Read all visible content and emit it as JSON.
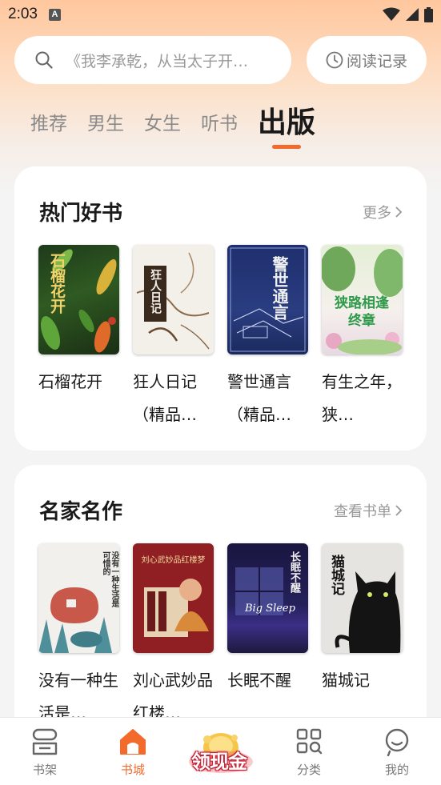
{
  "status": {
    "time": "2:03",
    "notification_letter": "A"
  },
  "search": {
    "placeholder": "《我李承乾，从当太子开…",
    "history_label": "阅读记录"
  },
  "tabs": [
    {
      "label": "推荐"
    },
    {
      "label": "男生"
    },
    {
      "label": "女生"
    },
    {
      "label": "听书"
    },
    {
      "label": "出版"
    }
  ],
  "sections": [
    {
      "title": "热门好书",
      "more_label": "更多",
      "books": [
        {
          "title": "石榴花开",
          "cover_text": "石榴花开"
        },
        {
          "title": "狂人日记（精品…",
          "cover_text": "狂人日记"
        },
        {
          "title": "警世通言（精品…",
          "cover_text": "警世通言"
        },
        {
          "title": "有生之年，狭…",
          "cover_text": "狭路相逢终章"
        }
      ]
    },
    {
      "title": "名家名作",
      "more_label": "查看书单",
      "books": [
        {
          "title": "没有一种生活是…",
          "cover_text": "没有一种生活是可惜的"
        },
        {
          "title": "刘心武妙品红楼…",
          "cover_text": "刘心武妙品红楼梦"
        },
        {
          "title": "长眠不醒",
          "cover_text": "长眠不醒",
          "cover_subtext": "Big Sleep"
        },
        {
          "title": "猫城记",
          "cover_text": "猫城记"
        }
      ]
    }
  ],
  "bottom_nav": [
    {
      "label": "书架",
      "icon": "bookshelf-icon"
    },
    {
      "label": "书城",
      "icon": "store-home-icon"
    },
    {
      "label": "领现金",
      "icon": "cash-reward-icon"
    },
    {
      "label": "分类",
      "icon": "category-grid-icon"
    },
    {
      "label": "我的",
      "icon": "profile-icon"
    }
  ],
  "colors": {
    "accent": "#f26b2c",
    "header_gradient_top": "#ffc79e"
  }
}
